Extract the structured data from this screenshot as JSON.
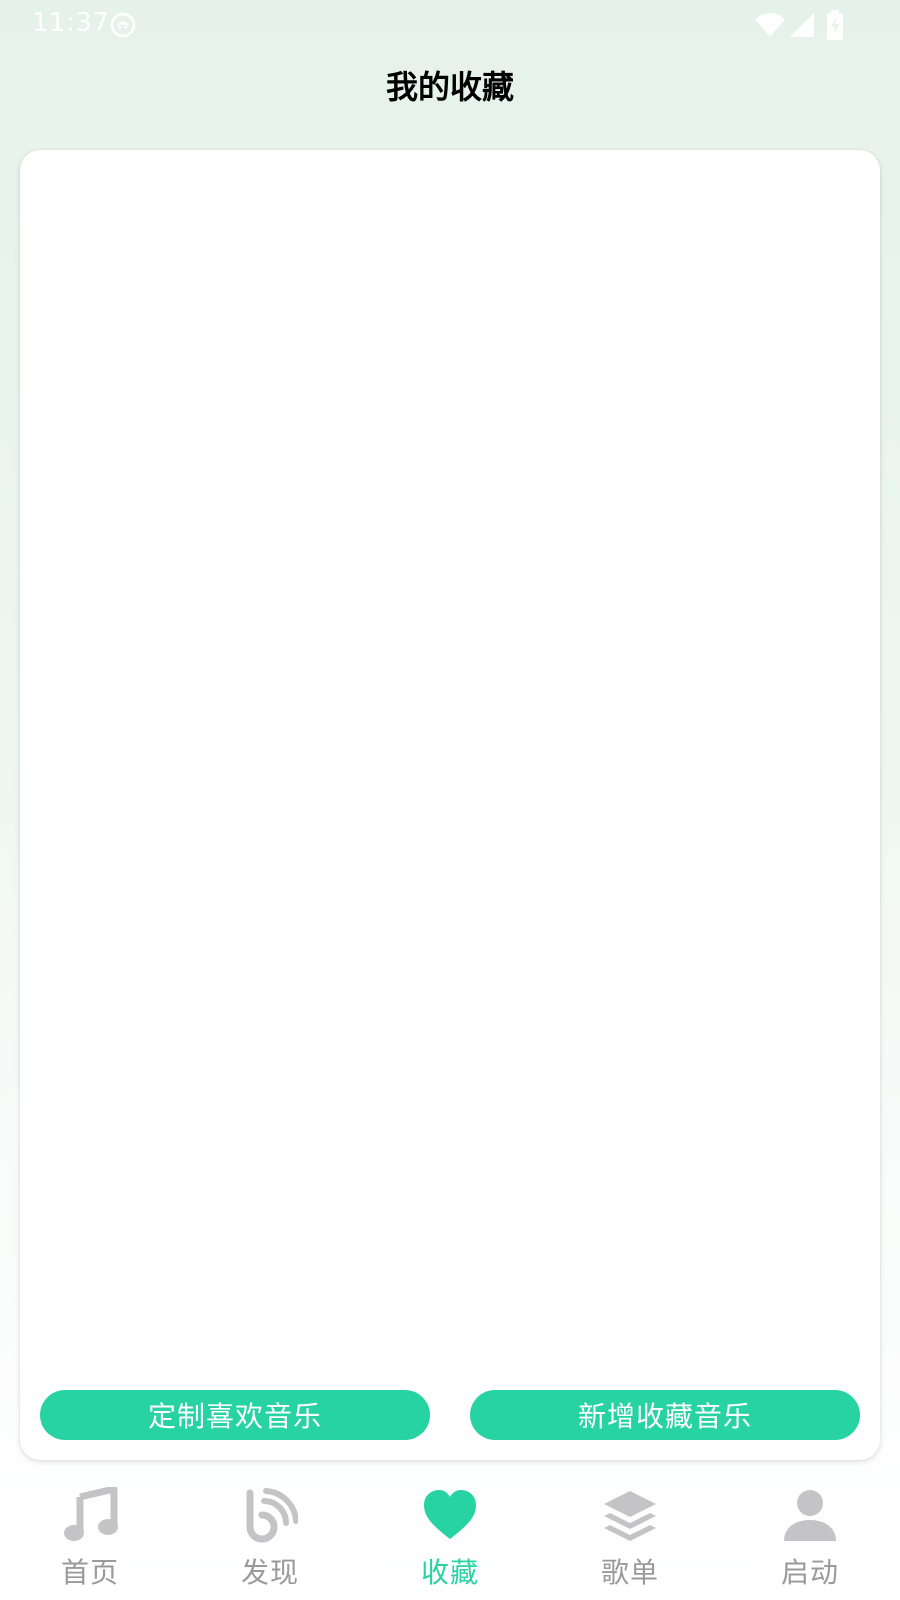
{
  "status_bar": {
    "time": "11:37",
    "icons": [
      "notification-face-icon",
      "wifi-icon",
      "cell-signal-icon",
      "battery-charging-icon"
    ]
  },
  "header": {
    "title": "我的收藏"
  },
  "card": {
    "buttons": {
      "custom_favorite_label": "定制喜欢音乐",
      "add_favorite_label": "新增收藏音乐"
    }
  },
  "bottom_nav": {
    "active_index": 2,
    "items": [
      {
        "label": "首页",
        "icon": "music-note-icon"
      },
      {
        "label": "发现",
        "icon": "discover-feed-icon"
      },
      {
        "label": "收藏",
        "icon": "heart-icon"
      },
      {
        "label": "歌单",
        "icon": "layers-icon"
      },
      {
        "label": "启动",
        "icon": "person-icon"
      }
    ]
  },
  "colors": {
    "accent": "#27d3a3",
    "inactive_icon": "#c4c4c6",
    "inactive_label": "#9a9a9a",
    "background_top": "#e5f2ea"
  }
}
